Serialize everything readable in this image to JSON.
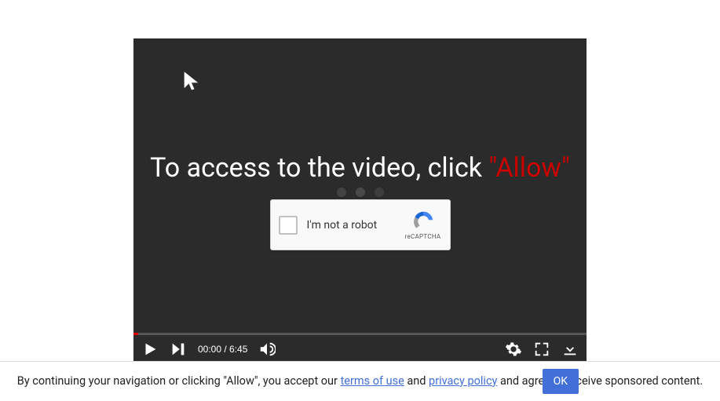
{
  "overlay": {
    "prefix": "To access to the video, click ",
    "allow": "\"Allow\""
  },
  "recaptcha": {
    "label": "I'm not a robot",
    "brand": "reCAPTCHA"
  },
  "controls": {
    "time": "00:00 / 6:45"
  },
  "consent": {
    "part1": "By continuing your navigation or clicking \"Allow\", you accept our ",
    "terms_label": "terms of use",
    "mid": " and ",
    "privacy_label": "privacy policy",
    "part2": " and agree to receive sponsored content.",
    "ok": "OK"
  }
}
